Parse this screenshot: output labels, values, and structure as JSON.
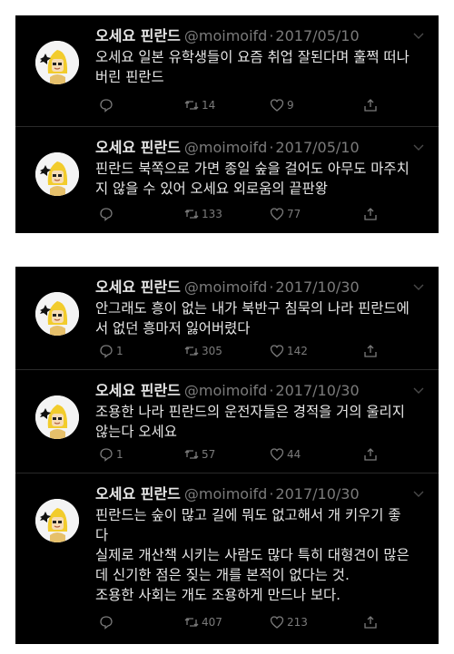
{
  "panels": [
    {
      "tweets": [
        {
          "name": "오세요 핀란드",
          "handle": "@moimoifd",
          "date": "2017/05/10",
          "text": "오세요 일본 유학생들이 요즘 취업 잘된다며 훌쩍 떠나\n버린 핀란드",
          "reply": "",
          "retweet": "14",
          "like": "9"
        },
        {
          "name": "오세요 핀란드",
          "handle": "@moimoifd",
          "date": "2017/05/10",
          "text": "핀란드 북쪽으로 가면 종일 숲을 걸어도 아무도 마주치\n지 않을 수 있어 오세요 외로움의 끝판왕",
          "reply": "",
          "retweet": "133",
          "like": "77"
        }
      ]
    },
    {
      "tweets": [
        {
          "name": "오세요 핀란드",
          "handle": "@moimoifd",
          "date": "2017/10/30",
          "text": "안그래도 흥이 없는 내가 북반구 침묵의 나라 핀란드에\n서 없던 흥마저 잃어버렸다",
          "reply": "1",
          "retweet": "305",
          "like": "142"
        },
        {
          "name": "오세요 핀란드",
          "handle": "@moimoifd",
          "date": "2017/10/30",
          "text": "조용한 나라 핀란드의 운전자들은 경적을 거의 울리지\n않는다 오세요",
          "reply": "1",
          "retweet": "57",
          "like": "44"
        },
        {
          "name": "오세요 핀란드",
          "handle": "@moimoifd",
          "date": "2017/10/30",
          "text": "핀란드는 숲이 많고 길에 뭐도 없고해서 개 키우기 좋\n다\n실제로 개산책 시키는 사람도 많다 특히 대형견이 많은\n데 신기한 점은 짖는 개를 본적이 없다는 것.\n조용한 사회는 개도 조용하게 만드나 보다.",
          "reply": "",
          "retweet": "407",
          "like": "213"
        }
      ]
    }
  ],
  "separator": "·",
  "icons": {
    "avatar": "blond-character-avatar",
    "reply": "speech-bubble-icon",
    "retweet": "retweet-arrows-icon",
    "like": "heart-outline-icon",
    "share": "share-upload-icon",
    "menu": "chevron-down-icon"
  },
  "colors": {
    "background": "#000000",
    "text": "#e8e8e8",
    "muted": "#7b7b7b",
    "page": "#ffffff"
  }
}
